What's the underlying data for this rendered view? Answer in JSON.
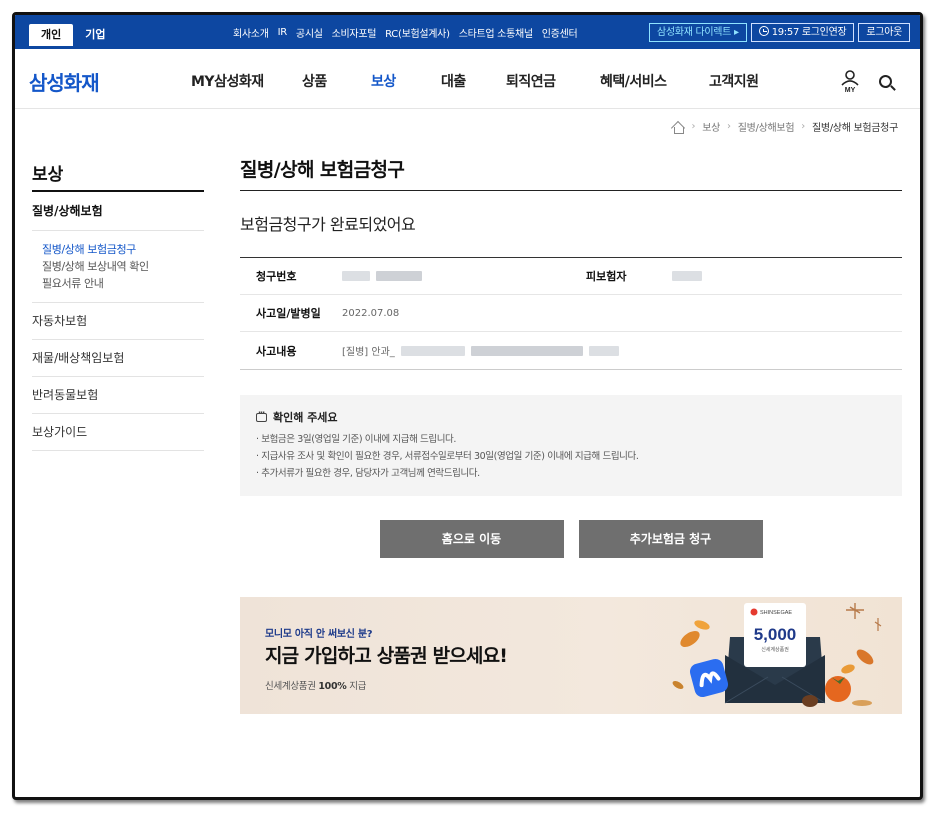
{
  "util": {
    "tabs": [
      "개인",
      "기업"
    ],
    "links": [
      "회사소개",
      "IR",
      "공시실",
      "소비자포털",
      "RC(보험설계사)",
      "스타트업 소통채널",
      "인증센터"
    ],
    "direct_label": "삼성화재 다이렉트 ▸",
    "extend_label": "19:57 로그인연장",
    "logout_label": "로그아웃"
  },
  "nav": {
    "logo": "삼성화재",
    "items": [
      "MY삼성화재",
      "상품",
      "보상",
      "대출",
      "퇴직연금",
      "혜택/서비스",
      "고객지원"
    ],
    "active": "보상",
    "my_label": "MY"
  },
  "breadcrumb": [
    "보상",
    "질병/상해보험",
    "질병/상해 보험금청구"
  ],
  "sidebar": {
    "title": "보상",
    "group_head": "질병/상해보험",
    "sub_items": [
      "질병/상해 보험금청구",
      "질병/상해 보상내역 확인",
      "필요서류 안내"
    ],
    "items": [
      "자동차보험",
      "재물/배상책임보험",
      "반려동물보험",
      "보상가이드"
    ]
  },
  "page": {
    "title": "질병/상해 보험금청구",
    "subtitle": "보험금청구가 완료되었어요",
    "rows": {
      "claim_no_label": "청구번호",
      "insured_label": "피보험자",
      "date_label": "사고일/발병일",
      "date_value": "2022.07.08",
      "content_label": "사고내용",
      "content_prefix": "[질병] 안과_"
    }
  },
  "notice": {
    "title": "확인해 주세요",
    "lines": [
      "· 보험금은 3일(영업일 기준) 이내에 지급해 드립니다.",
      "· 지급사유 조사 및 확인이 필요한 경우, 서류접수일로부터 30일(영업일 기준) 이내에 지급해 드립니다.",
      "· 추가서류가 필요한 경우, 담당자가 고객님께 연락드립니다."
    ]
  },
  "buttons": {
    "home": "홈으로 이동",
    "additional": "추가보험금 청구"
  },
  "banner": {
    "eyebrow": "모니모 아직 안 써보신 분?",
    "title": "지금 가입하고 상품권 받으세요!",
    "sub_prefix": "신세계상품권 ",
    "sub_bold": "100%",
    "sub_suffix": " 지급",
    "card_brand": "SHINSEGAE",
    "card_amount": "5,000",
    "card_caption": "신세계상품권"
  },
  "colors": {
    "primary": "#1457c9",
    "utilbar": "#0d47a1",
    "button": "#6f6f6f"
  }
}
